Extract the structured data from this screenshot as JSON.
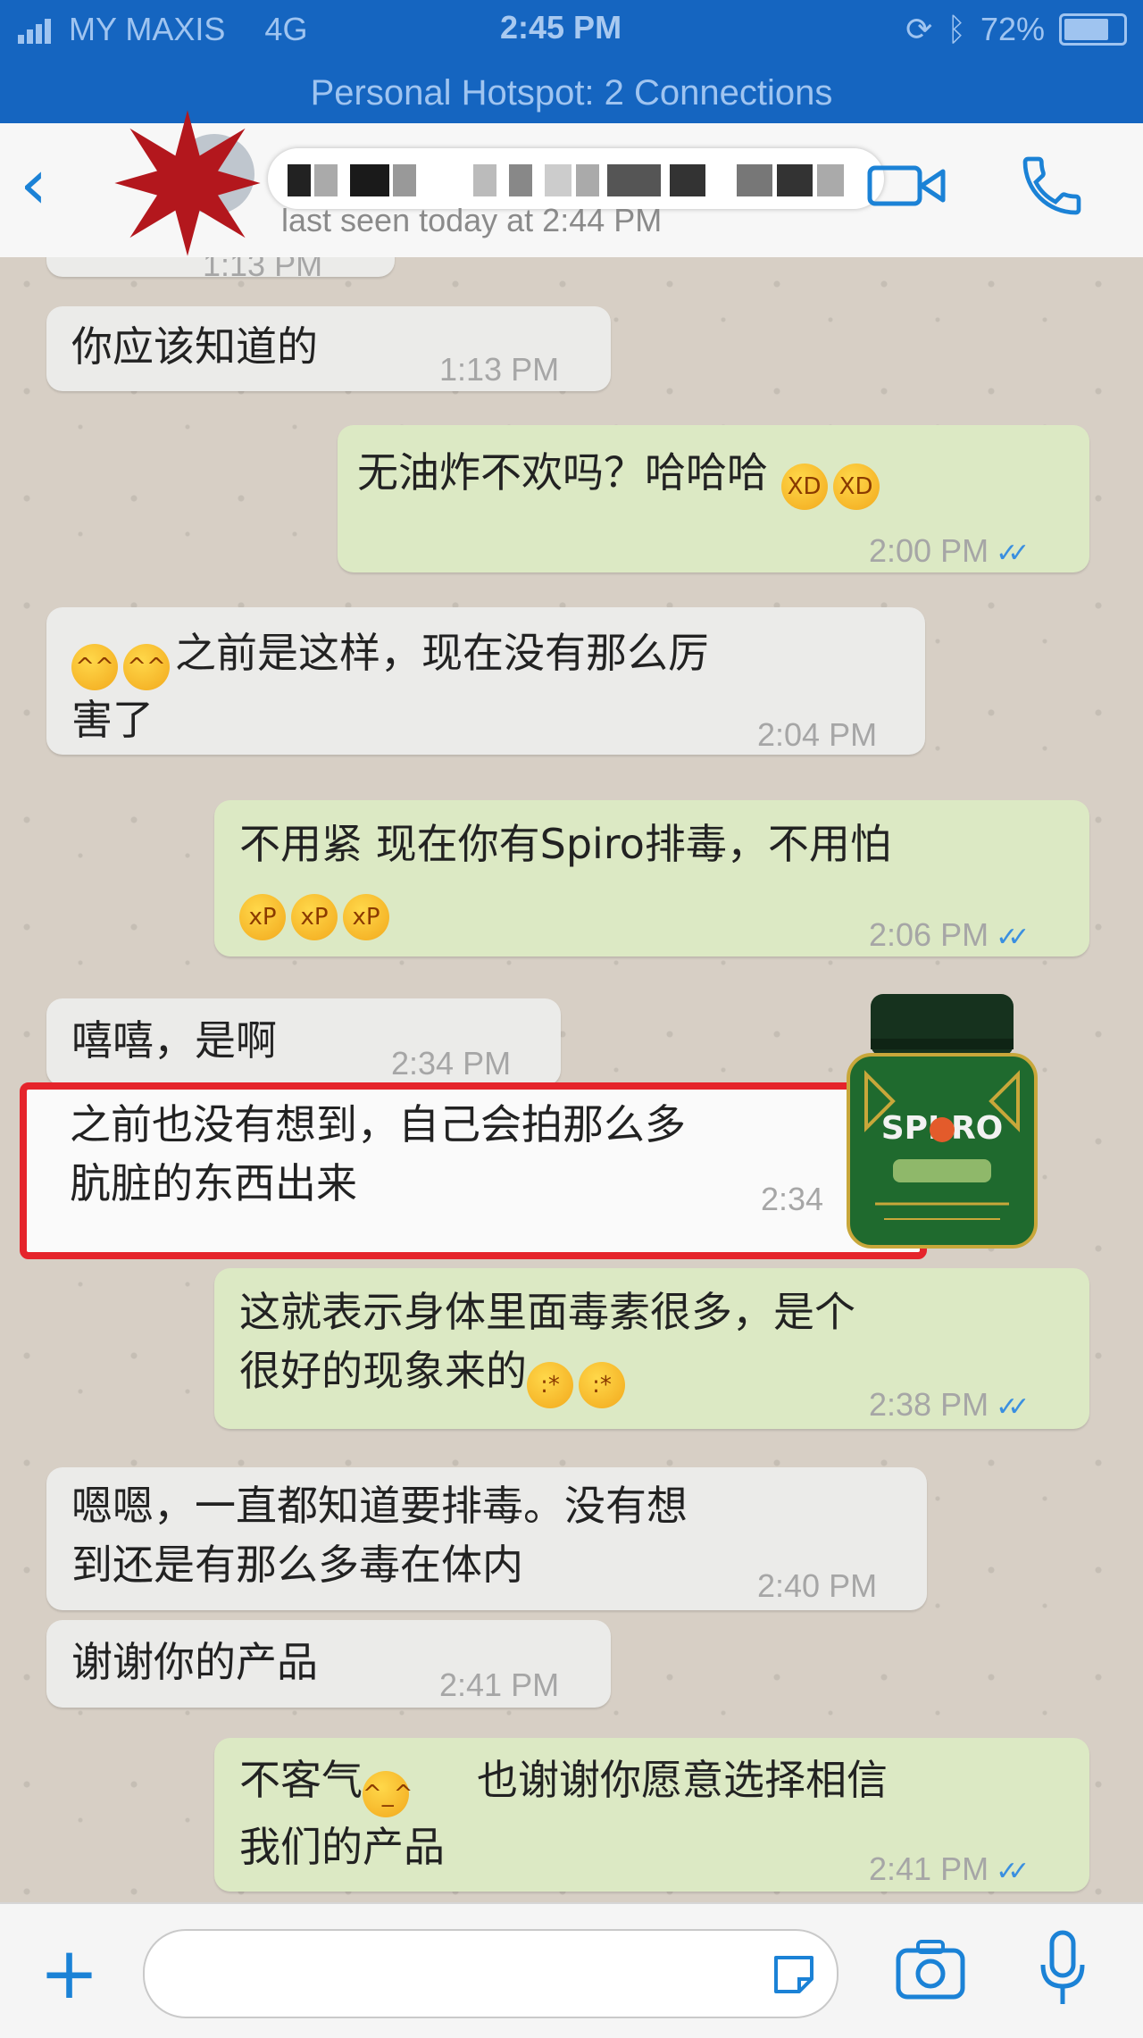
{
  "status_bar": {
    "carrier": "MY MAXIS",
    "network": "4G",
    "time": "2:45 PM",
    "battery": "72%"
  },
  "hotspot": "Personal Hotspot: 2 Connections",
  "header": {
    "last_seen": "last seen today at 2:44 PM"
  },
  "messages": [
    {
      "dir": "in",
      "text": "你应该知道的",
      "time": "1:13 PM"
    },
    {
      "dir": "out",
      "text": "无油炸不欢吗？哈哈哈",
      "time": "2:00 PM"
    },
    {
      "dir": "in",
      "text1": "之前是这样，现在没有那么厉",
      "text2": "害了",
      "time": "2:04 PM"
    },
    {
      "dir": "out",
      "text": "不用紧 现在你有Spiro排毒，不用怕",
      "time": "2:06 PM"
    },
    {
      "dir": "in",
      "text": "嘻嘻，是啊",
      "time": "2:34 PM"
    },
    {
      "dir": "in",
      "text1": "之前也没有想到，自己会拍那么多",
      "text2": "肮脏的东西出来",
      "time": "2:34"
    },
    {
      "dir": "out",
      "text1": "这就表示身体里面毒素很多，是个",
      "text2": "很好的现象来的",
      "time": "2:38 PM"
    },
    {
      "dir": "in",
      "text1": "嗯嗯，一直都知道要排毒。没有想",
      "text2": "到还是有那么多毒在体内",
      "time": "2:40 PM"
    },
    {
      "dir": "in",
      "text": "谢谢你的产品",
      "time": "2:41 PM"
    },
    {
      "dir": "out",
      "text1a": "不客气",
      "text1b": "也谢谢你愿意选择相信",
      "text2": "我们的产品",
      "time": "2:41 PM"
    }
  ],
  "partial_top_time": "1:13 PM",
  "product_label": "SPI RO",
  "colors": {
    "accent": "#1b82d6",
    "status_bar": "#1565c0",
    "outgoing": "#dce9c4",
    "incoming": "#ebebe9",
    "highlight": "#e5242b"
  }
}
